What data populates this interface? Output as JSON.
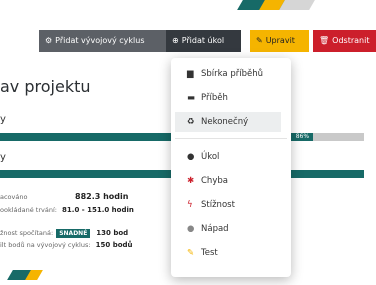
{
  "colors": {
    "accent": "#176a67",
    "yellow": "#f5b400",
    "red": "#cc1f2b",
    "dark": "#34393f",
    "gray": "#5c6066"
  },
  "toolbar": {
    "add_cycle_label": "Přidat vývojový cyklus",
    "add_cycle_icon": "gears-icon",
    "add_task_label": "Přidat úkol",
    "add_task_icon": "plus-circle-icon",
    "edit_label": "Upravit",
    "edit_icon": "edit-icon",
    "delete_label": "Odstranit",
    "delete_icon": "trash-icon"
  },
  "main": {
    "title": "av projektu",
    "progress_1_label": "y",
    "progress_1_percent_text": "86%",
    "progress_1_value": 0.86,
    "progress_2_label": "y",
    "progress_2_value": 1.0,
    "stats": {
      "row1_label": "acováno",
      "row1_value": "882.3 hodin",
      "row2_label": "ookládané trvání:",
      "row2_value": "81.0 - 151.0 hodin",
      "row3_label": "žnost spočítaná:",
      "row3_badge": "SNADNÉ",
      "row3_value": "130 bod",
      "row4_label": "ilt bodů na vývojový cyklus:",
      "row4_value": "150 bodů"
    }
  },
  "dropdown": {
    "items": [
      {
        "label": "Sbírka příběhů",
        "icon": "book-icon",
        "glyph": "▆",
        "color": "#333"
      },
      {
        "label": "Příběh",
        "icon": "ticket-icon",
        "glyph": "▬",
        "color": "#333"
      },
      {
        "label": "Nekonečný",
        "icon": "recycle-icon",
        "glyph": "♻",
        "color": "#333"
      },
      {
        "label": "Úkol",
        "icon": "check-circle-icon",
        "glyph": "●",
        "color": "#333"
      },
      {
        "label": "Chyba",
        "icon": "bug-icon",
        "glyph": "✱",
        "color": "#cc1f2b"
      },
      {
        "label": "Stížnost",
        "icon": "bolt-icon",
        "glyph": "ϟ",
        "color": "#cc1f2b"
      },
      {
        "label": "Nápad",
        "icon": "lightbulb-icon",
        "glyph": "●",
        "color": "#888"
      },
      {
        "label": "Test",
        "icon": "pencil-icon",
        "glyph": "✎",
        "color": "#f5b400"
      }
    ]
  }
}
